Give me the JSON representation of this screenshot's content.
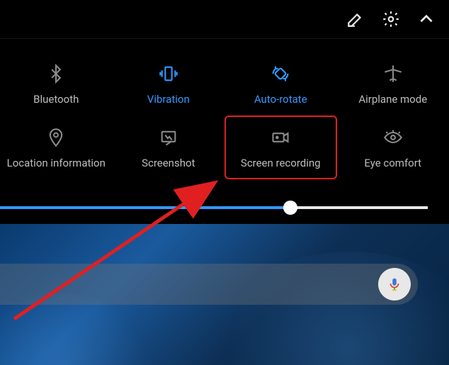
{
  "topbar": {
    "edit_icon": "edit-icon",
    "settings_icon": "settings-icon",
    "collapse_icon": "collapse-icon"
  },
  "tiles": {
    "row1": [
      {
        "label": "Bluetooth",
        "active": false,
        "name": "bluetooth"
      },
      {
        "label": "Vibration",
        "active": true,
        "name": "vibration"
      },
      {
        "label": "Auto-rotate",
        "active": true,
        "name": "auto-rotate"
      },
      {
        "label": "Airplane mode",
        "active": false,
        "name": "airplane-mode"
      }
    ],
    "row2": [
      {
        "label": "Location information",
        "active": false,
        "name": "location"
      },
      {
        "label": "Screenshot",
        "active": false,
        "name": "screenshot"
      },
      {
        "label": "Screen recording",
        "active": false,
        "name": "screen-recording",
        "highlighted": true
      },
      {
        "label": "Eye comfort",
        "active": false,
        "name": "eye-comfort"
      }
    ]
  },
  "brightness": {
    "percent": 68
  },
  "annotation": {
    "target": "screen-recording",
    "color": "#e02020"
  },
  "search": {
    "mic_icon": "mic-icon"
  }
}
